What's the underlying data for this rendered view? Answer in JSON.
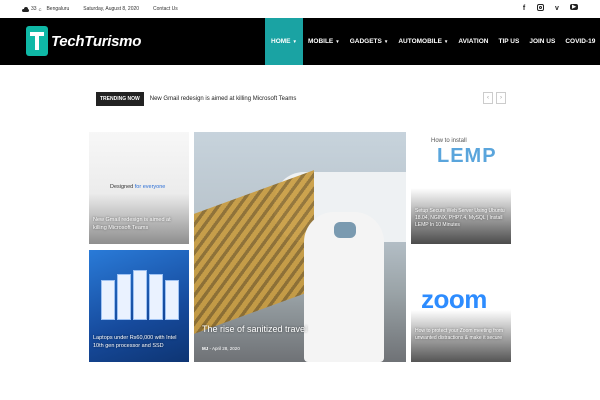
{
  "topbar": {
    "temperature": "33",
    "temp_unit": "C",
    "city": "Bengaluru",
    "date": "Saturday, August 8, 2020",
    "contact": "Contact Us",
    "social_icons": [
      "facebook-icon",
      "instagram-icon",
      "vimeo-icon",
      "youtube-icon"
    ]
  },
  "brand": {
    "name": "TechTurismo",
    "accent": "#1aa3a3"
  },
  "nav": {
    "items": [
      {
        "label": "HOME",
        "dropdown": true
      },
      {
        "label": "MOBILE",
        "dropdown": true
      },
      {
        "label": "GADGETS",
        "dropdown": true
      },
      {
        "label": "AUTOMOBILE",
        "dropdown": true
      },
      {
        "label": "AVIATION",
        "dropdown": false
      },
      {
        "label": "TIP US",
        "dropdown": false
      },
      {
        "label": "JOIN US",
        "dropdown": false
      },
      {
        "label": "COVID-19",
        "dropdown": false
      }
    ]
  },
  "trending": {
    "badge": "TRENDING NOW",
    "headline": "New Gmail redesign is aimed at killing Microsoft Teams"
  },
  "tiles": {
    "gmail": {
      "image_text_prefix": "Designed",
      "image_text_highlight": "for everyone",
      "title": "New Gmail redesign is aimed at killing Microsoft Teams"
    },
    "laptops": {
      "title": "Laptops under Rs60,000 with Intel 10th gen processor and SSD"
    },
    "featured": {
      "title": "The rise of sanitized travel",
      "author": "MJ",
      "date": "April 28, 2020"
    },
    "lemp": {
      "image_text_top": "How to install",
      "image_text_big": "LEMP",
      "title": "Setup Secure Web Server Using Ubuntu 18.04, NGINX, PHP7.4, MySQL | Install LEMP In 10 Minutes"
    },
    "zoom": {
      "image_text": "zoom",
      "title": "How to protect your Zoom meeting from unwanted distractions & make it secure"
    }
  }
}
